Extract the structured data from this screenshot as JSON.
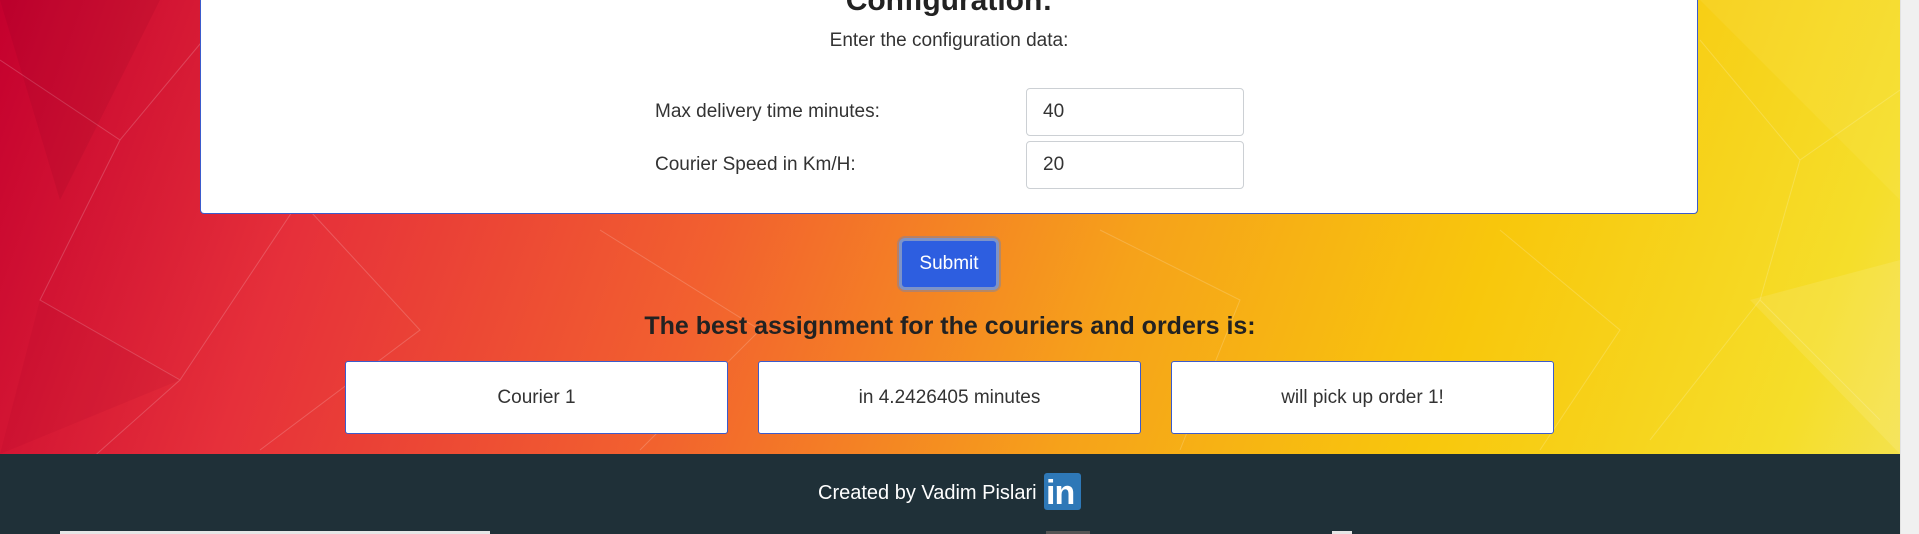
{
  "config": {
    "title": "Configuration:",
    "subtitle": "Enter the configuration data:",
    "fields": [
      {
        "label": "Max delivery time minutes:",
        "value": "40"
      },
      {
        "label": "Courier Speed in Km/H:",
        "value": "20"
      }
    ]
  },
  "submit_label": "Submit",
  "results": {
    "heading": "The best assignment for the couriers and orders is:",
    "boxes": [
      "Courier 1",
      "in 4.2426405 minutes",
      "will pick up order 1!"
    ]
  },
  "footer": {
    "text": "Created by Vadim Pislari",
    "icon": "linkedin-icon",
    "icon_text": "in"
  },
  "colors": {
    "button": "#2d5ee0",
    "footer_bg": "#1f3038",
    "card_border": "#3b5bcc",
    "linkedin": "#2e78b7"
  }
}
